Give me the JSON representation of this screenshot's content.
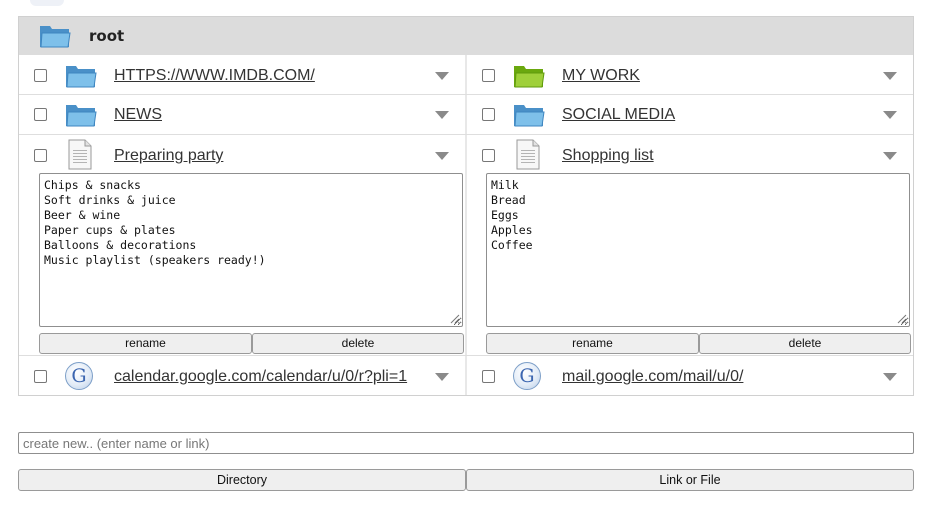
{
  "root": {
    "label": "root",
    "icon": "folder-open-icon"
  },
  "rows": [
    {
      "left": {
        "label": "HTTPS://WWW.IMDB.COM/",
        "icon": "folder-blue-icon"
      },
      "right": {
        "label": "MY WORK",
        "icon": "folder-green-icon"
      }
    },
    {
      "left": {
        "label": "NEWS",
        "icon": "folder-blue-icon"
      },
      "right": {
        "label": "SOCIAL MEDIA",
        "icon": "folder-blue-icon"
      }
    },
    {
      "left": {
        "label": "Preparing party",
        "icon": "document-icon",
        "lines": [
          "Chips & snacks",
          "Soft drinks & juice",
          "Beer & wine",
          "Paper cups & plates",
          "Balloons & decorations",
          "Music playlist (speakers ready!)"
        ]
      },
      "right": {
        "label": "Shopping list",
        "icon": "document-icon",
        "lines": [
          "Milk",
          "Bread",
          "Eggs",
          "Apples",
          "Coffee"
        ]
      }
    },
    {
      "left": {
        "label": "calendar.google.com/calendar/u/0/r?pli=1",
        "icon": "google-icon",
        "glyph": "G"
      },
      "right": {
        "label": "mail.google.com/mail/u/0/",
        "icon": "google-icon",
        "glyph": "G"
      }
    }
  ],
  "actions": {
    "rename": "rename",
    "delete": "delete"
  },
  "create": {
    "placeholder": "create new.. (enter name or link)",
    "directory_label": "Directory",
    "link_or_file_label": "Link or File"
  }
}
